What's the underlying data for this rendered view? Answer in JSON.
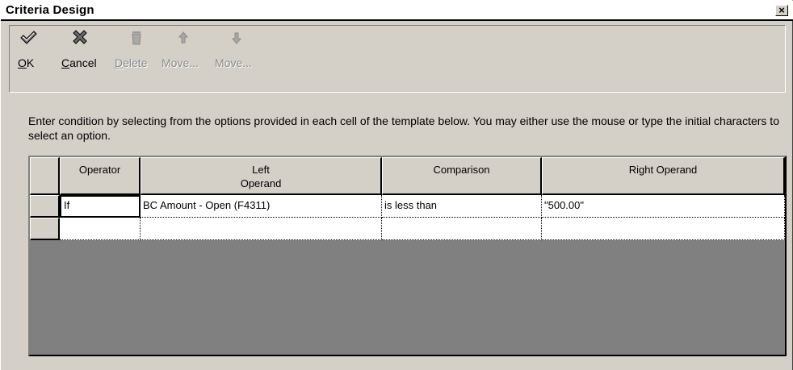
{
  "window": {
    "title": "Criteria Design",
    "close_glyph": "×"
  },
  "toolbar": {
    "buttons": [
      {
        "label": "OK",
        "mnemonic": "O",
        "rest": "K",
        "icon": "check-icon",
        "enabled": true
      },
      {
        "label": "Cancel",
        "mnemonic": "C",
        "rest": "ancel",
        "icon": "x-icon",
        "enabled": true
      },
      {
        "label": "Delete",
        "mnemonic": "D",
        "rest": "elete",
        "icon": "trash-icon",
        "enabled": false
      },
      {
        "label": "Move...",
        "mnemonic": "",
        "rest": "Move...",
        "icon": "arrow-up-icon",
        "enabled": false
      },
      {
        "label": "Move...",
        "mnemonic": "",
        "rest": "Move...",
        "icon": "arrow-down-icon",
        "enabled": false
      }
    ]
  },
  "instructions": "Enter condition by selecting from the options provided in each cell of the template below. You may either use the mouse or type the initial characters to select an option.",
  "grid": {
    "columns": [
      {
        "line1": "Operator",
        "line2": ""
      },
      {
        "line1": "Left",
        "line2": "Operand"
      },
      {
        "line1": "Comparison",
        "line2": ""
      },
      {
        "line1": "Right Operand",
        "line2": ""
      }
    ],
    "rows": [
      [
        "If",
        "BC Amount - Open (F4311)",
        "is less than",
        "\"500.00\""
      ],
      [
        "",
        "",
        "",
        ""
      ]
    ]
  },
  "colors": {
    "face": "#d4d0c8",
    "grid_background": "#808080",
    "disabled_text": "#8a8a8a"
  }
}
